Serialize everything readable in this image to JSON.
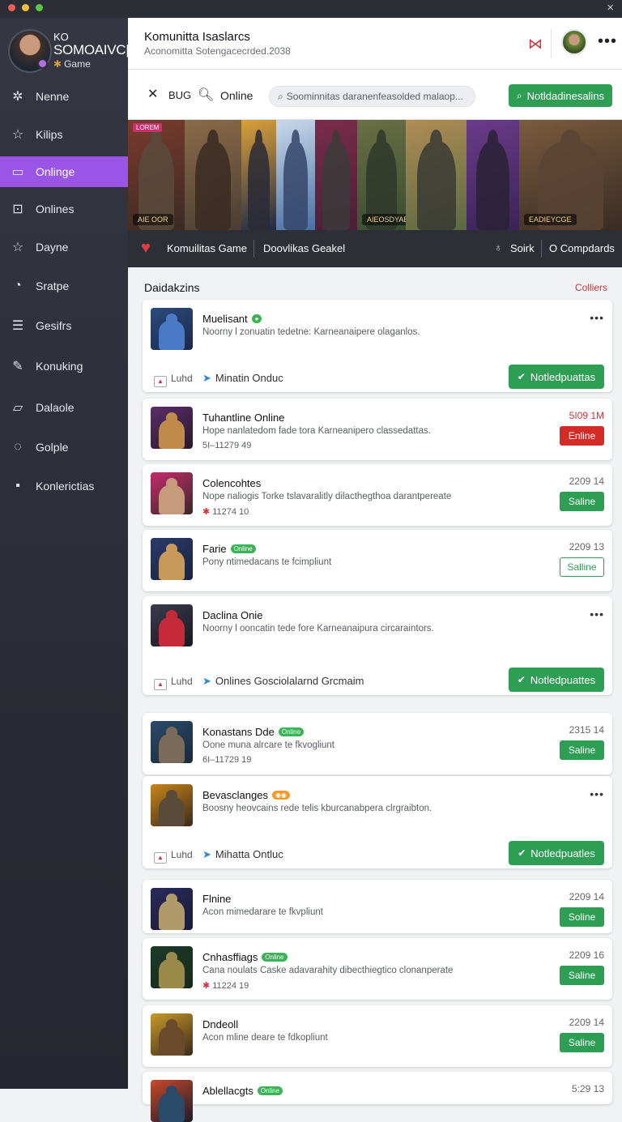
{
  "window": {
    "close_icon": "×"
  },
  "profile": {
    "line1": "KO",
    "line2": "SOMOAIVC|",
    "line3": "Game"
  },
  "sidebar": {
    "items": [
      {
        "label": "Nenne",
        "icon": "✲",
        "name": "nodes-icon"
      },
      {
        "label": "Kilips",
        "icon": "☆",
        "name": "star-icon"
      },
      {
        "label": "Onlinge",
        "icon": "▭",
        "name": "window-icon",
        "active": true
      },
      {
        "label": "Onlines",
        "icon": "⊡",
        "name": "grid-icon"
      },
      {
        "label": "Dayne",
        "icon": "☆",
        "name": "star-outline-icon"
      },
      {
        "label": "Sratpe",
        "icon": "◔",
        "name": "clock-icon"
      },
      {
        "label": "Gesifrs",
        "icon": "☰",
        "name": "list-icon"
      },
      {
        "label": "Konuking",
        "icon": "✎",
        "name": "pencil-icon"
      },
      {
        "label": "Dalaole",
        "icon": "▱",
        "name": "folder-icon"
      },
      {
        "label": "Golple",
        "icon": "◌",
        "name": "refresh-icon"
      },
      {
        "label": "Konlerictias",
        "icon": "▪",
        "name": "tile-icon"
      }
    ]
  },
  "header": {
    "title": "Komunitta Isaslarcs",
    "subtitle": "Aconomitta Sotengacecrded.2038",
    "brand_icon": "⋈",
    "more_icon": "•••"
  },
  "toolbar": {
    "close_icon": "✕",
    "bug_label": "BUG",
    "search_icon": "🔍︎",
    "online_label": "Online",
    "search_placeholder": "Soominnitas daranenfeasolded malaop...",
    "button_label": "Notldadinesalins"
  },
  "banner": {
    "tiles": [
      {
        "tag": "LOREM",
        "caption": "AIE OOR",
        "bg1": "#3a2a22",
        "bg2": "#7a3b2c",
        "fig": "#5b4a3b",
        "tagcolor": "#c6326d"
      },
      {
        "tag": "",
        "caption": "",
        "bg1": "#4b3d33",
        "bg2": "#8a6b49",
        "fig": "#3b2a22",
        "tagcolor": "#c6326d"
      },
      {
        "tag": "",
        "caption": "",
        "bg1": "#1f2a47",
        "bg2": "#d9a03a",
        "fig": "#2a2a35",
        "tagcolor": "#c6326d"
      },
      {
        "tag": "",
        "caption": "",
        "bg1": "#4a6fa3",
        "bg2": "#c9d9ea",
        "fig": "#34476a",
        "tagcolor": "#c6326d"
      },
      {
        "tag": "",
        "caption": "",
        "bg1": "#4a1f36",
        "bg2": "#7a2c4a",
        "fig": "#3b3b3b",
        "tagcolor": "#c6326d"
      },
      {
        "tag": "",
        "caption": "AIEOSDYAEIE",
        "bg1": "#3a4c33",
        "bg2": "#6a6f43",
        "fig": "#30382a",
        "tagcolor": "#c6326d"
      },
      {
        "tag": "",
        "caption": "",
        "bg1": "#5a6a42",
        "bg2": "#b08c55",
        "fig": "#3a3a34",
        "tagcolor": "#e07b1a"
      },
      {
        "tag": "",
        "caption": "",
        "bg1": "#3b2358",
        "bg2": "#6a3b8a",
        "fig": "#2a2236",
        "tagcolor": "#c6326d"
      },
      {
        "tag": "",
        "caption": "EADIEYCGE",
        "bg1": "#3a2b22",
        "bg2": "#7a5b3e",
        "fig": "#5b4433",
        "tagcolor": "#c6326d"
      }
    ]
  },
  "tabbar": {
    "heart_icon": "♥",
    "tab1": "Komuilitas Game",
    "tab2": "Doovlikas Geakel",
    "lock_icon": "♁",
    "tab3": "Soirk",
    "tab4": "O Compdards"
  },
  "section": {
    "title": "Daidakzins",
    "link": "Colliers"
  },
  "cards": [
    {
      "title": "Muelisant",
      "badge": "●",
      "badge_type": "green",
      "desc": "Noorny l zonuatin tedetne: Karneanaipere olaganlos.",
      "meta": "",
      "date": "",
      "dots": "•••",
      "btn": "",
      "btn_type": "",
      "expanded": true,
      "foot_left": "Luhd",
      "foot_mid": "Minatin Onduc",
      "foot_btn": "Notledpuattas",
      "colors": [
        "#2b4a7d",
        "#4a7ac6",
        "#1b2a4a"
      ]
    },
    {
      "title": "Tuhantline Online",
      "badge": "",
      "desc": "Hope nanlatedom fade tora Karneanipero classedattas.",
      "meta": "5I–11279 49",
      "date": "5I09 1M",
      "date_red": true,
      "btn": "Enline",
      "btn_type": "red",
      "colors": [
        "#5a2d6a",
        "#c08a4a",
        "#2a1a2a"
      ]
    },
    {
      "title": "Colencohtes",
      "badge": "",
      "desc": "Nope naliogis Torke tslavaralitly dilacthegthoa darantpereate",
      "meta": "11274 10",
      "meta_star": true,
      "date": "2209 14",
      "btn": "Saline",
      "btn_type": "green",
      "colors": [
        "#c42a6a",
        "#c69a7a",
        "#3a2a2a"
      ]
    },
    {
      "title": "Farie",
      "badge": "Online",
      "badge_type": "green",
      "desc": "Pony ntimedacans te fcimpliunt",
      "meta": "",
      "date": "2209 13",
      "btn": "Salline",
      "btn_type": "outline",
      "colors": [
        "#2b3a6a",
        "#c89a5a",
        "#1a2340"
      ]
    },
    {
      "title": "Daclina Onie",
      "badge": "",
      "desc": "Noorny l ooncatin tede fore Karneanaipura circaraintors.",
      "meta": "",
      "date": "",
      "dots": "•••",
      "expanded": true,
      "foot_left": "Luhd",
      "foot_mid": "Onlines Gosciolalarnd Grcmaim",
      "foot_btn": "Notledpuattes",
      "colors": [
        "#3a3a4a",
        "#c42a3a",
        "#1a1a24"
      ]
    },
    {
      "title": "Konastans Dde",
      "badge": "Online",
      "badge_type": "green",
      "desc": "Oone muna alrcare te fkvogliunt",
      "meta": "6I–11729 19",
      "date": "2315 14",
      "btn": "Saline",
      "btn_type": "green",
      "colors": [
        "#2a4a6a",
        "#7a6a5a",
        "#1a2a3a"
      ]
    },
    {
      "title": "Bevasclanges",
      "badge": "◉◉",
      "badge_type": "orange",
      "desc": "Boosny heovcains rede telis kburcanabpera clrgraibton.",
      "meta": "",
      "date": "",
      "dots": "•••",
      "expanded": true,
      "foot_left": "Luhd",
      "foot_mid": "Mihatta Ontluc",
      "foot_btn": "Notledpuatles",
      "colors": [
        "#c8861a",
        "#5a4a3a",
        "#3a2a1a"
      ]
    },
    {
      "title": "Flnine",
      "badge": "",
      "desc": "Acon mimedarare te fkvpliunt",
      "meta": "",
      "date": "2209 14",
      "btn": "Soline",
      "btn_type": "green",
      "colors": [
        "#2a2a5a",
        "#b09a6a",
        "#1a1a3a"
      ]
    },
    {
      "title": "Cnhasffiags",
      "badge": "Online",
      "badge_type": "green",
      "desc": "Cana noulats Caske adavarahity dibecthiegtico clonanperate",
      "meta": "11224 19",
      "meta_star": true,
      "date": "2209 16",
      "btn": "Saline",
      "btn_type": "green",
      "colors": [
        "#1a3a2a",
        "#9a8a4a",
        "#1a2a1a"
      ]
    },
    {
      "title": "Dndeoll",
      "badge": "",
      "desc": "Acon mline deare te fdkopliunt",
      "meta": "",
      "date": "2209 14",
      "btn": "Saline",
      "btn_type": "green",
      "colors": [
        "#c89a2a",
        "#6a4a2a",
        "#3a2a1a"
      ]
    },
    {
      "title": "Ablellacgts",
      "badge": "Online",
      "badge_type": "green",
      "desc": "",
      "meta": "",
      "date": "5:29 13",
      "btn": "",
      "btn_type": "",
      "colors": [
        "#c84a2a",
        "#2a4a6a",
        "#1a1a2a"
      ]
    }
  ]
}
